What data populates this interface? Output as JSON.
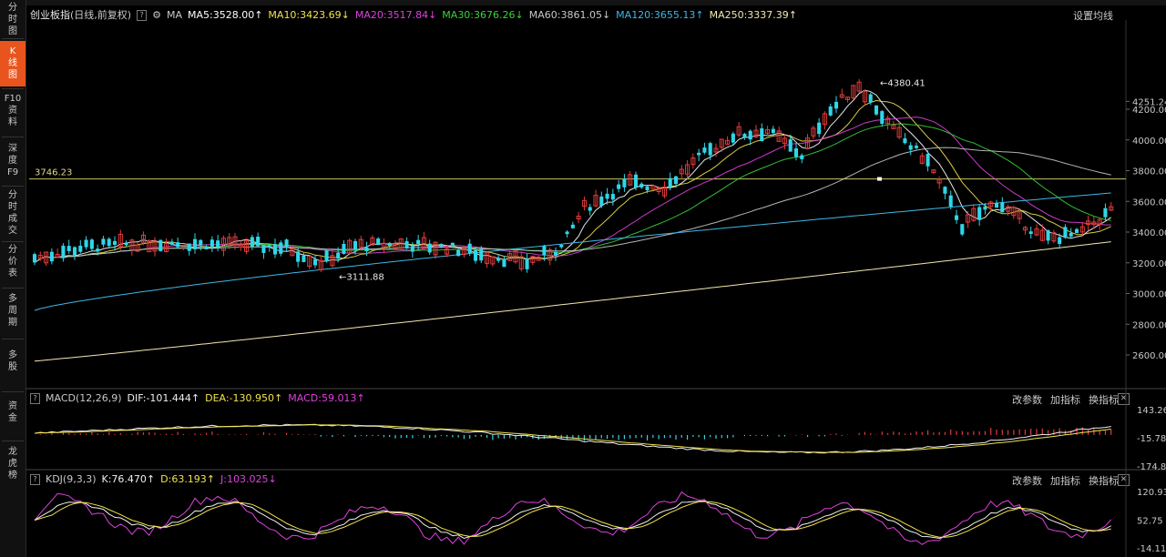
{
  "sidebar": [
    {
      "label": "分\n时\n图",
      "active": false
    },
    {
      "label": "K\n线\n图",
      "active": true
    },
    {
      "label": "F10\n资\n料",
      "active": false
    },
    {
      "label": "深\n度\nF9",
      "active": false
    },
    {
      "label": "分\n时\n成\n交",
      "active": false
    },
    {
      "label": "分\n价\n表",
      "active": false
    },
    {
      "label": "多\n周\n期",
      "active": false
    },
    {
      "label": "多\n股",
      "active": false
    },
    {
      "label": "资\n金",
      "active": false
    },
    {
      "label": "龙\n虎\n榜",
      "active": false
    }
  ],
  "main": {
    "name": "创业板指",
    "mode": "(日线,前复权)",
    "ma_label": "MA",
    "ma_items": [
      {
        "text": "MA5:3528.00↑",
        "color": "#ffffff"
      },
      {
        "text": "MA10:3423.69↓",
        "color": "#f2e34c"
      },
      {
        "text": "MA20:3517.84↓",
        "color": "#e040e0"
      },
      {
        "text": "MA30:3676.26↓",
        "color": "#39d239"
      },
      {
        "text": "MA60:3861.05↓",
        "color": "#c8c8c8"
      },
      {
        "text": "MA120:3655.13↑",
        "color": "#3fb7e8"
      },
      {
        "text": "MA250:3337.39↑",
        "color": "#f2e8b0"
      }
    ],
    "settings_label": "设置均线",
    "ref_line_label": "3746.23",
    "high_label": "4380.41",
    "low_label": "3111.88",
    "axis_labels": [
      "4251.24",
      "4200.00",
      "4000.00",
      "3800.00",
      "3600.00",
      "3400.00",
      "3200.00",
      "3000.00",
      "2800.00",
      "2600.00"
    ]
  },
  "macd": {
    "name": "MACD(12,26,9)",
    "dif": "DIF:-101.444↑",
    "dea": "DEA:-130.950↑",
    "macd": "MACD:59.013↑",
    "links": [
      "改参数",
      "加指标",
      "换指标"
    ],
    "axis_labels": [
      "143.26",
      "-15.78",
      "-174.82"
    ]
  },
  "kdj": {
    "name": "KDJ(9,3,3)",
    "k": "K:76.470↑",
    "d": "D:63.193↑",
    "j": "J:103.025↓",
    "links": [
      "改参数",
      "加指标",
      "换指标"
    ],
    "axis_labels": [
      "120.93",
      "52.75",
      "-14.11"
    ]
  },
  "close_glyph": "✕",
  "help_glyph": "?",
  "colors": {
    "up": "#e23b3b",
    "down": "#2fd6e8",
    "accent": "#e8541d"
  },
  "chart_data": [
    {
      "type": "candlestick",
      "title": "创业板指 (日线,前复权)",
      "ylim": [
        2500,
        4300
      ],
      "ref_line": 3746.23,
      "high": 4380.41,
      "low": 3111.88,
      "ma": {
        "MA5": 3528.0,
        "MA10": 3423.69,
        "MA20": 3517.84,
        "MA30": 3676.26,
        "MA60": 3861.05,
        "MA120": 3655.13,
        "MA250": 3337.39
      }
    },
    {
      "type": "bar",
      "title": "MACD(12,26,9)",
      "ylim": [
        -174.82,
        143.26
      ],
      "DIF": -101.444,
      "DEA": -130.95,
      "MACD": 59.013
    },
    {
      "type": "line",
      "title": "KDJ(9,3,3)",
      "ylim": [
        -14.11,
        120.93
      ],
      "K": 76.47,
      "D": 63.193,
      "J": 103.025
    }
  ]
}
